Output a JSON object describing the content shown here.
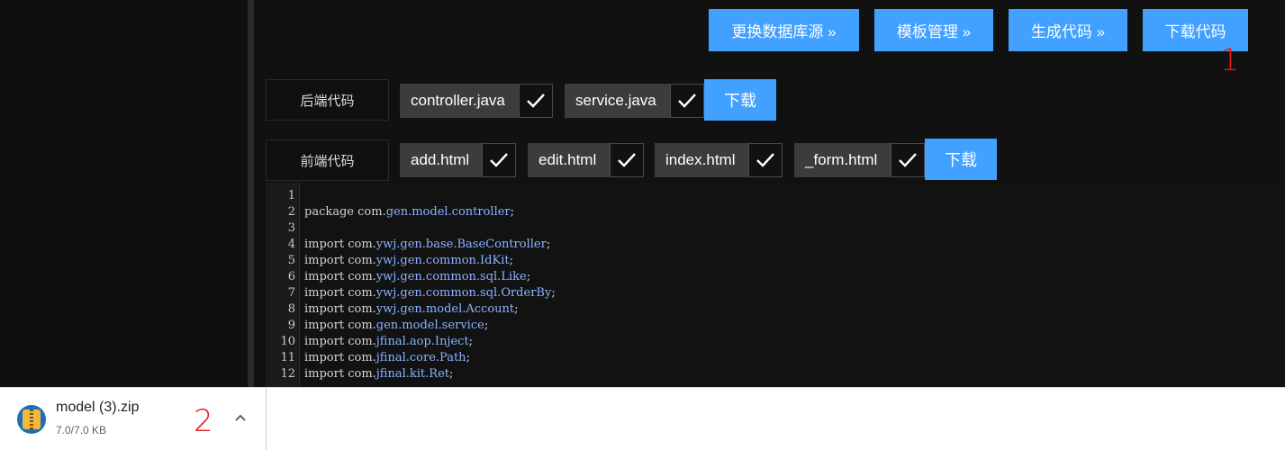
{
  "toolbar": {
    "buttons": [
      "更换数据库源 »",
      "模板管理 »",
      "生成代码 »",
      "下载代码"
    ]
  },
  "annotations": {
    "one": "1",
    "two": "2"
  },
  "backend": {
    "label": "后端代码",
    "files": [
      "controller.java",
      "service.java"
    ],
    "download": "下载"
  },
  "frontend": {
    "label": "前端代码",
    "files": [
      "add.html",
      "edit.html",
      "index.html",
      "_form.html"
    ],
    "download": "下载"
  },
  "editor": {
    "line_numbers": [
      "1",
      "2",
      "3",
      "4",
      "5",
      "6",
      "7",
      "8",
      "9",
      "10",
      "11",
      "12"
    ],
    "lines": [
      {
        "kw": "",
        "pre": "",
        "pkg": "",
        "post": ""
      },
      {
        "kw": "package",
        "pre": " com.",
        "pkg": "gen.model.controller",
        "post": ";"
      },
      {
        "kw": "",
        "pre": "",
        "pkg": "",
        "post": ""
      },
      {
        "kw": "import",
        "pre": " com.",
        "pkg": "ywj.gen.base.BaseController",
        "post": ";"
      },
      {
        "kw": "import",
        "pre": " com.",
        "pkg": "ywj.gen.common.IdKit",
        "post": ";"
      },
      {
        "kw": "import",
        "pre": " com.",
        "pkg": "ywj.gen.common.sql.Like",
        "post": ";"
      },
      {
        "kw": "import",
        "pre": " com.",
        "pkg": "ywj.gen.common.sql.OrderBy",
        "post": ";"
      },
      {
        "kw": "import",
        "pre": " com.",
        "pkg": "ywj.gen.model.Account",
        "post": ";"
      },
      {
        "kw": "import",
        "pre": " com.",
        "pkg": "gen.model.service",
        "post": ";"
      },
      {
        "kw": "import",
        "pre": " com.",
        "pkg": "jfinal.aop.Inject",
        "post": ";"
      },
      {
        "kw": "import",
        "pre": " com.",
        "pkg": "jfinal.core.Path",
        "post": ";"
      },
      {
        "kw": "import",
        "pre": " com.",
        "pkg": "jfinal.kit.Ret",
        "post": ";"
      }
    ]
  },
  "download_bar": {
    "filename": "model (3).zip",
    "progress": "7.0/7.0 KB"
  },
  "icons": {
    "check": "check-icon",
    "zip": "zip-archive-icon",
    "chevron": "chevron-up-icon"
  },
  "colors": {
    "accent": "#42a0ff",
    "annotation": "#e8161b"
  }
}
